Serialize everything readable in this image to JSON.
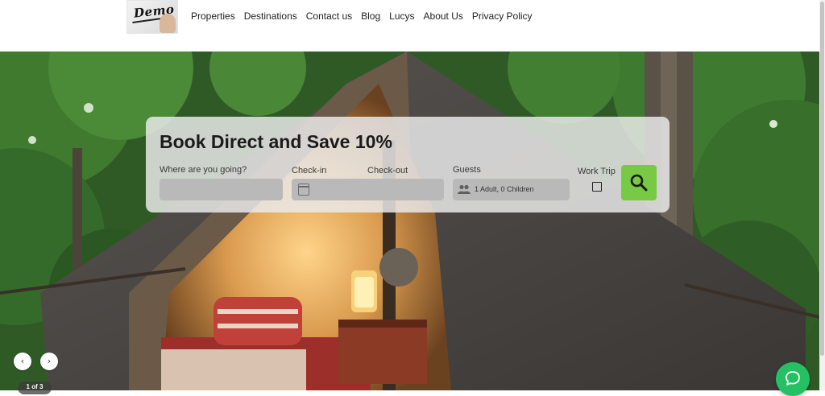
{
  "header": {
    "logo_text": "Demo",
    "nav": [
      "Properties",
      "Destinations",
      "Contact us",
      "Blog",
      "Lucys",
      "About Us",
      "Privacy Policy"
    ]
  },
  "hero": {
    "slider": {
      "counter": "1 of 3",
      "prev_icon": "‹",
      "next_icon": "›"
    }
  },
  "booking": {
    "title": "Book Direct and Save 10%",
    "destination": {
      "label": "Where are you going?",
      "value": ""
    },
    "checkin": {
      "label": "Check-in"
    },
    "checkout": {
      "label": "Check-out"
    },
    "guests": {
      "label": "Guests",
      "value": "1 Adult, 0 Children"
    },
    "work_trip": {
      "label": "Work Trip",
      "checked": false
    },
    "search_icon": "search-icon"
  },
  "colors": {
    "search_button": "#78c943",
    "chat_button": "#25c064",
    "panel": "#ebebeb"
  }
}
